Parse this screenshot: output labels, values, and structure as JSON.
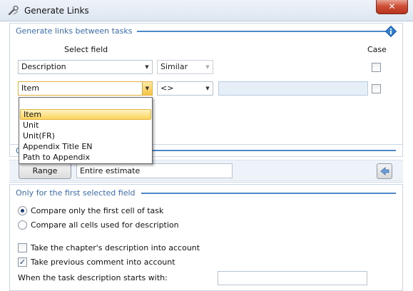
{
  "window": {
    "title": "Generate Links",
    "close_glyph": "✕",
    "app_icon": "tools-icon"
  },
  "section1": {
    "header": "Generate links between tasks",
    "info_icon": "info-icon",
    "select_field_label": "Select field",
    "case_label": "Case",
    "row1": {
      "field": "Description",
      "operator": "Similar",
      "case_checked": false
    },
    "row2": {
      "field": "Item",
      "operator": "<>",
      "value": "",
      "case_checked": false
    },
    "dropdown_options": [
      "Item",
      "Unit",
      "Unit(FR)",
      "Appendix Title EN",
      "Path to Appendix"
    ],
    "dropdown_selected": "Item"
  },
  "section2": {
    "header_fragment": "O",
    "range_button": "Range",
    "range_value": "Entire estimate",
    "side_icon": "arrow-left-icon"
  },
  "section3": {
    "header": "Only for the first selected field",
    "radio1": {
      "label": "Compare only the first cell of task",
      "checked": true
    },
    "radio2": {
      "label": "Compare all cells used for description",
      "checked": false
    },
    "check1": {
      "label": "Take the chapter's description into account",
      "checked": false
    },
    "check2": {
      "label": "Take previous comment into account",
      "checked": true
    },
    "starts_with_label": "When the task description starts with:",
    "starts_with_value": ""
  },
  "colors": {
    "accent": "#4b89c8",
    "header_text": "#3a6db3",
    "close_red": "#cf4f36"
  }
}
